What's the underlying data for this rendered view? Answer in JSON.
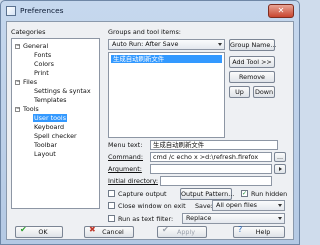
{
  "window": {
    "title": "Preferences",
    "close_symbol": "✕"
  },
  "categories": {
    "label": "Categories",
    "items": [
      {
        "label": "General",
        "expander": "−",
        "children": [
          "Fonts",
          "Colors",
          "Print"
        ]
      },
      {
        "label": "Files",
        "expander": "−",
        "children": [
          "Settings & syntax",
          "Templates"
        ]
      },
      {
        "label": "Tools",
        "expander": "−",
        "children": [
          "User tools",
          "Keyboard",
          "Spell checker",
          "Toolbar",
          "Layout"
        ]
      }
    ],
    "selected": "User tools"
  },
  "groups": {
    "label": "Groups and tool items:",
    "group_value": "Auto Run: After Save",
    "tool_items": [
      "生成自动刷新文件"
    ],
    "group_name_button": "Group Name...",
    "add_tool_button": "Add Tool >>",
    "remove_button": "Remove",
    "up_button": "Up",
    "down_button": "Down"
  },
  "fields": {
    "menu_text_label": "Menu text:",
    "menu_text_value": "生成自动刷新文件",
    "command_label": "Command:",
    "command_value": "cmd /c echo x >d:\\refresh.firefox",
    "browse_button": "...",
    "argument_label": "Argument:",
    "argument_value": "",
    "initial_dir_label": "Initial directory:",
    "initial_dir_value": ""
  },
  "options": {
    "capture_output": {
      "label": "Capture output",
      "checked": false
    },
    "output_pattern_button": "Output Pattern...",
    "run_hidden": {
      "label": "Run hidden",
      "checked": true
    },
    "close_on_exit": {
      "label": "Close window on exit",
      "checked": false
    },
    "save_label": "Save:",
    "save_value": "All open files",
    "run_as_filter": {
      "label": "Run as text filter:",
      "checked": false
    },
    "filter_value": "Replace"
  },
  "footer": {
    "ok": "OK",
    "cancel": "Cancel",
    "apply": "Apply",
    "help": "Help"
  },
  "colors": {
    "selection": "#3399ff",
    "title_bar": "#c6d8ee",
    "dialog_bg": "#eef0f3"
  }
}
